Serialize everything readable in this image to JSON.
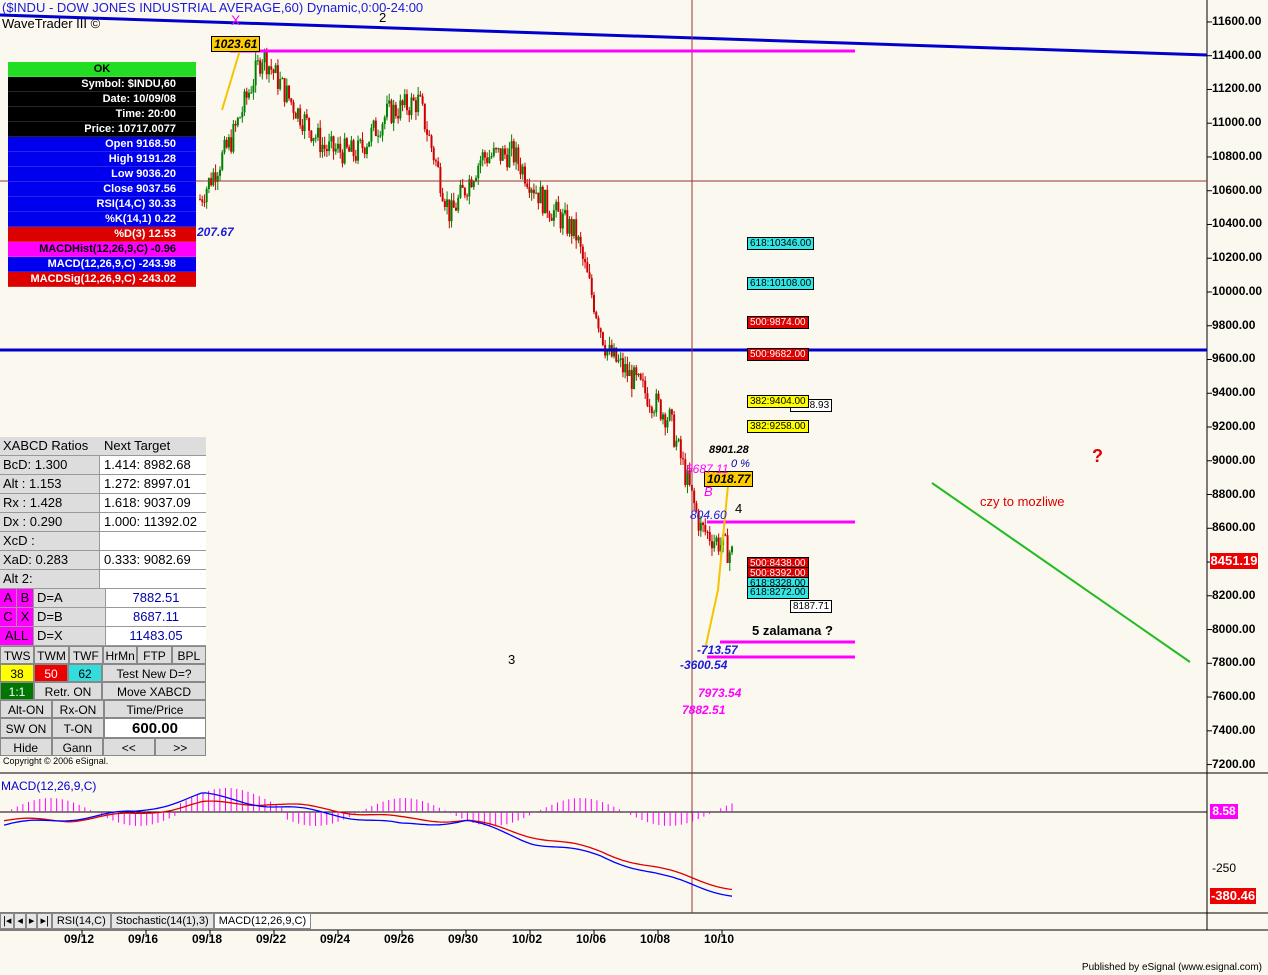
{
  "window": {
    "title": "($INDU - DOW JONES INDUSTRIAL AVERAGE,60) Dynamic,0:00-24:00",
    "brand": "WaveTrader III ©",
    "copyright": "Copyright © 2006 eSignal.",
    "footer": "Published by eSignal (www.esignal.com)"
  },
  "info_box": {
    "ok": "OK",
    "symbol": "Symbol: $INDU,60",
    "date": "Date: 10/09/08",
    "time": "Time: 20:00",
    "price": "Price: 10717.0077",
    "open": "Open 9168.50",
    "high": "High 9191.28",
    "low": "Low 9036.20",
    "close": "Close 9037.56",
    "rsi": "RSI(14,C) 30.33",
    "k": "%K(14,1) 0.22",
    "d": "%D(3) 12.53",
    "macdhist": "MACDHist(12,26,9,C) -0.96",
    "macd": "MACD(12,26,9,C) -243.98",
    "macdsig": "MACDSig(12,26,9,C) -243.02"
  },
  "xabcd_panel": {
    "header": "XABCD Ratios",
    "header2": "Next Target",
    "rows": [
      {
        "label": "BcD:   1.300",
        "value": "1.414: 8982.68"
      },
      {
        "label": "Alt  :   1.153",
        "value": "1.272: 8997.01"
      },
      {
        "label": "Rx   :   1.428",
        "value": "1.618: 9037.09"
      },
      {
        "label": "Dx   :   0.290",
        "value": "1.000: 11392.02"
      },
      {
        "label": "XcD :",
        "value": ""
      },
      {
        "label": "XaD:   0.283",
        "value": "0.333: 9082.69"
      },
      {
        "label": "Alt 2:",
        "value": ""
      }
    ],
    "targets": [
      {
        "a": "A",
        "b": "B",
        "label": "D=A",
        "value": "7882.51"
      },
      {
        "a": "C",
        "b": "X",
        "label": "D=B",
        "value": "8687.11"
      },
      {
        "a": "ALL",
        "b": "",
        "label": "D=X",
        "value": "11483.05"
      }
    ],
    "buttons1": [
      "TWS",
      "TWM",
      "TWF",
      "HrMn",
      "FTP",
      "BPL"
    ],
    "nums": [
      "38",
      "50",
      "62"
    ],
    "test_btn": "Test New D=?",
    "ratio_btn": "1:1",
    "retr_btn": "Retr. ON",
    "move_btn": "Move XABCD",
    "alt_btn": "Alt-ON",
    "rx_btn": "Rx-ON",
    "timeprice_btn": "Time/Price",
    "sw_btn": "SW ON",
    "ton_btn": "T-ON",
    "value_display": "600.00",
    "hide_btn": "Hide",
    "gann_btn": "Gann",
    "prev_btn": "<<",
    "next_btn": ">>"
  },
  "price_axis": [
    "11600.00",
    "11400.00",
    "11200.00",
    "11000.00",
    "10800.00",
    "10600.00",
    "10400.00",
    "10200.00",
    "10000.00",
    "9800.00",
    "9600.00",
    "9400.00",
    "9200.00",
    "9000.00",
    "8800.00",
    "8600.00",
    "8400.00",
    "8200.00",
    "8000.00",
    "7800.00",
    "7600.00",
    "7400.00",
    "7200.00"
  ],
  "current_price": "8451.19",
  "macd_axis": {
    "zero_label": "8.58",
    "mid": "-250",
    "current": "-380.46"
  },
  "macd_label": "MACD(12,26,9,C)",
  "date_axis": [
    "09/12",
    "09/16",
    "09/18",
    "09/22",
    "09/24",
    "09/26",
    "09/30",
    "10/02",
    "10/06",
    "10/08",
    "10/10"
  ],
  "tabs": [
    "RSI(14,C)",
    "Stochastic(14(1),3)",
    "MACD(12,26,9,C)"
  ],
  "annotations": {
    "x_label": "X",
    "label_2": "2",
    "label_3": "3",
    "label_4": "4",
    "label_b": "B",
    "tag_1023": "1023.61",
    "tag_1018": "1018.77",
    "fib_618a": "618:10346.00",
    "fib_618b": "618:10108.00",
    "fib_500a": "500:9874.00",
    "fib_500b": "500:9682.00",
    "fib_382a": "382:9404.00",
    "fib_382b": "382:9258.00",
    "fib_x8b": "9378.93",
    "v8901": "8901.28",
    "v8687": "8687.11",
    "pct": "0 %",
    "v804": "804.60",
    "fib_500c": "500:8438.00",
    "fib_500d": "500:8392.00",
    "fib_618c": "618:8328.00",
    "fib_618d": "618:8272.00",
    "v8187": "8187.71",
    "zalamana": "5 zalamana ?",
    "v713": "-713.57",
    "v3600": "-3600.54",
    "v7973": "7973.54",
    "v7882": "7882.51",
    "v0767": "207.67",
    "question": "?",
    "czy": "czy to mozliwe"
  },
  "colors": {
    "up": "#008000",
    "down": "#cc0000",
    "trend": "#0000cc",
    "magenta": "#ff00ff",
    "fib_cyan": "#33e6e6",
    "fib_red": "#dd0000",
    "fib_yellow": "#ffff00",
    "macd_line": "#0000ff",
    "signal_line": "#dd0000",
    "projection": "#22bb22"
  },
  "chart_data": {
    "type": "candlestick",
    "title": "($INDU - DOW JONES INDUSTRIAL AVERAGE,60) Dynamic,0:00-24:00",
    "ylim": [
      7150,
      11730
    ],
    "x": [
      "09/12",
      "09/16",
      "09/18",
      "09/22",
      "09/24",
      "09/26",
      "09/30",
      "10/02",
      "10/06",
      "10/08",
      "10/10"
    ],
    "price_path": [
      {
        "x": "09/17",
        "y": 10550
      },
      {
        "x": "09/18",
        "y": 10900
      },
      {
        "x": "09/19",
        "y": 11410
      },
      {
        "x": "09/22",
        "y": 11100
      },
      {
        "x": "09/23",
        "y": 10850
      },
      {
        "x": "09/24",
        "y": 10820
      },
      {
        "x": "09/25",
        "y": 11060
      },
      {
        "x": "09/26",
        "y": 11130
      },
      {
        "x": "09/29",
        "y": 10450
      },
      {
        "x": "09/30",
        "y": 10800
      },
      {
        "x": "10/01",
        "y": 10820
      },
      {
        "x": "10/02",
        "y": 10530
      },
      {
        "x": "10/03",
        "y": 10350
      },
      {
        "x": "10/06",
        "y": 9650
      },
      {
        "x": "10/07",
        "y": 9450
      },
      {
        "x": "10/08",
        "y": 9250
      },
      {
        "x": "10/09",
        "y": 8600
      },
      {
        "x": "10/10",
        "y": 8451.19
      }
    ],
    "macd": {
      "series": [
        {
          "name": "MACD(12,26,9,C)",
          "values": [
            -60,
            -30,
            0,
            80,
            30,
            -10,
            -60,
            -40,
            -140,
            -200,
            -300,
            -380.46
          ]
        },
        {
          "name": "MACDSig",
          "values": [
            -40,
            -35,
            -10,
            40,
            40,
            10,
            -30,
            -40,
            -110,
            -180,
            -270,
            -350
          ]
        }
      ]
    }
  }
}
